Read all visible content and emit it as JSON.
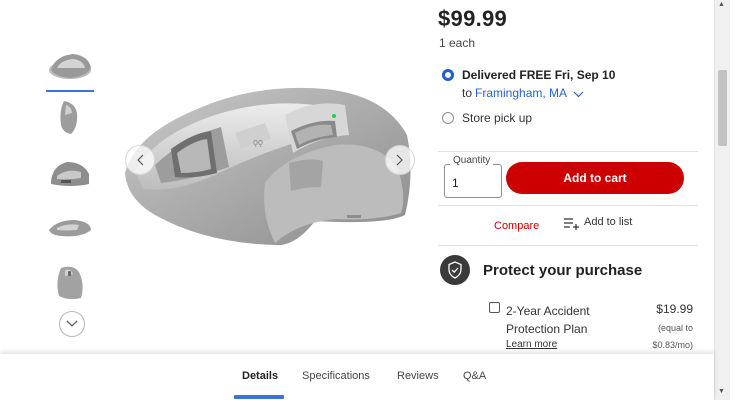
{
  "product": {
    "price": "$99.99",
    "unit": "1 each"
  },
  "fulfillment": {
    "delivery_label": "Delivered FREE Fri, Sep 10",
    "delivery_to_prefix": "to",
    "delivery_location": "Framingham, MA",
    "pickup_label": "Store pick up",
    "selected": "delivery"
  },
  "purchase": {
    "quantity_label": "Quantity",
    "quantity_value": "1",
    "add_to_cart_label": "Add to cart",
    "compare_label": "Compare",
    "add_to_list_label": "Add to list"
  },
  "protection": {
    "title": "Protect your purchase",
    "plan_name_line1": "2-Year Accident",
    "plan_name_line2": "Protection Plan",
    "plan_price": "$19.99",
    "plan_equal_line1": "(equal to",
    "plan_equal_line2": "$0.83/mo)",
    "learn_more_label": "Learn more"
  },
  "gallery": {
    "thumbnail_count": 5,
    "active_thumbnail": 0
  },
  "tabs": [
    {
      "label": "Details",
      "active": true
    },
    {
      "label": "Specifications",
      "active": false
    },
    {
      "label": "Reviews",
      "active": false
    },
    {
      "label": "Q&A",
      "active": false
    }
  ],
  "colors": {
    "accent_red": "#cc0000",
    "link_blue": "#2a63c9",
    "selection_blue": "#3e72d8"
  }
}
